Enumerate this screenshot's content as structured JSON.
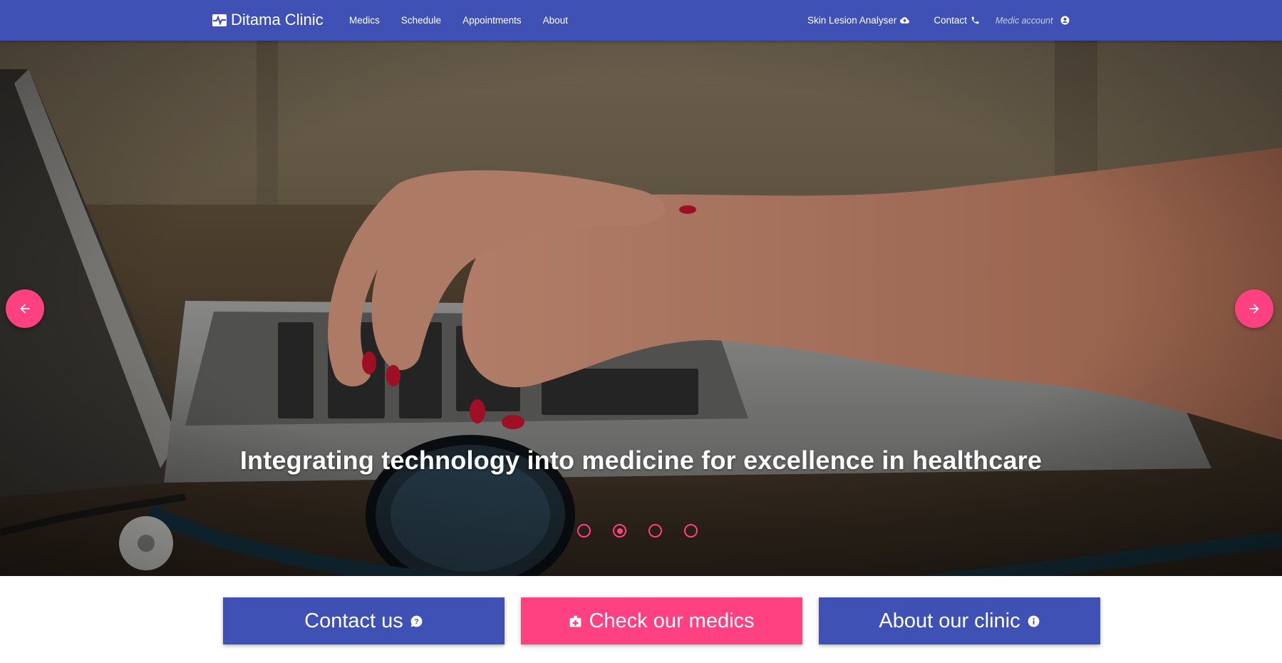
{
  "navbar": {
    "brand": "Ditama Clinic",
    "links": {
      "medics": "Medics",
      "schedule": "Schedule",
      "appointments": "Appointments",
      "about": "About"
    },
    "right": {
      "skin_lesion": "Skin Lesion Analyser",
      "contact": "Contact",
      "medic_account": "Medic account"
    },
    "colors": {
      "primary": "#3f51b5",
      "accent": "#ff4081"
    }
  },
  "carousel": {
    "caption": "Integrating technology into medicine for excellence in healthcare",
    "slide_count": 4,
    "active_index": 1,
    "prev_icon": "arrow-left-icon",
    "next_icon": "arrow-right-icon"
  },
  "actions": {
    "contact_us": "Contact us",
    "check_medics": "Check our medics",
    "about_clinic": "About our clinic"
  }
}
